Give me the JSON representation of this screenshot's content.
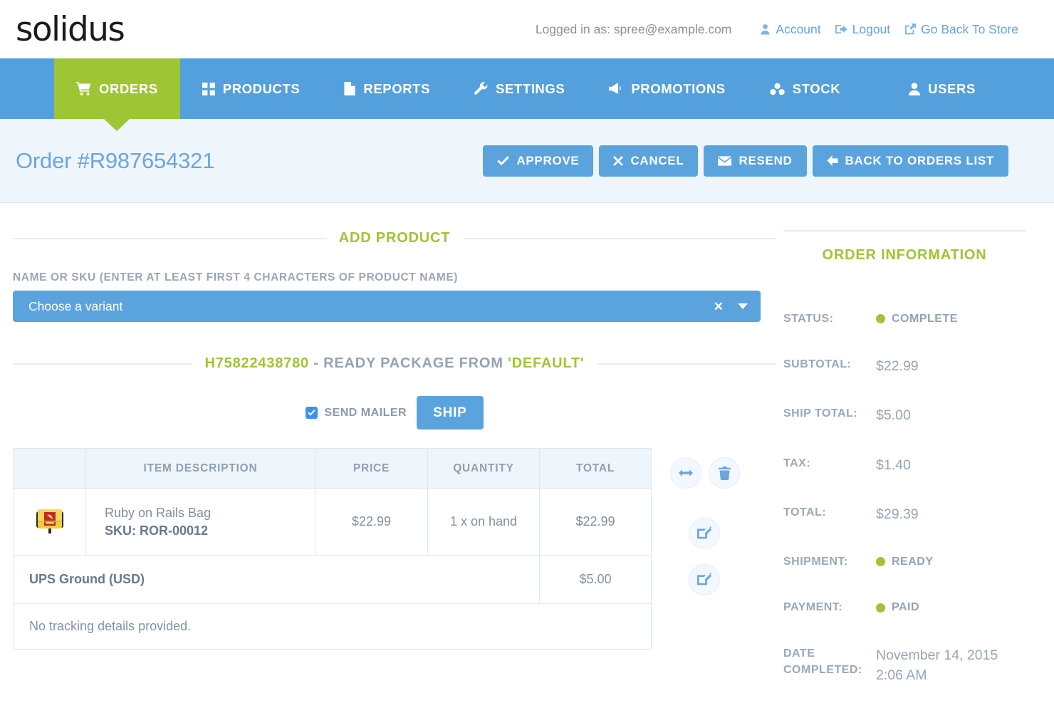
{
  "brand": {
    "logo_text": "solidus"
  },
  "header": {
    "logged_in_text": "Logged in as: spree@example.com",
    "links": [
      {
        "label": "Account",
        "icon": "user-icon"
      },
      {
        "label": "Logout",
        "icon": "logout-icon"
      },
      {
        "label": "Go Back To Store",
        "icon": "external-link-icon"
      }
    ]
  },
  "nav": {
    "items": [
      {
        "label": "ORDERS",
        "icon": "shopping-cart-icon",
        "active": true
      },
      {
        "label": "PRODUCTS",
        "icon": "grid-icon",
        "active": false
      },
      {
        "label": "REPORTS",
        "icon": "file-icon",
        "active": false
      },
      {
        "label": "SETTINGS",
        "icon": "wrench-icon",
        "active": false
      },
      {
        "label": "PROMOTIONS",
        "icon": "bullhorn-icon",
        "active": false
      },
      {
        "label": "STOCK",
        "icon": "cubes-icon",
        "active": false
      },
      {
        "label": "USERS",
        "icon": "user-icon",
        "active": false
      }
    ]
  },
  "titlebar": {
    "title": "Order #R987654321",
    "buttons": [
      {
        "label": "APPROVE",
        "icon": "check-icon"
      },
      {
        "label": "CANCEL",
        "icon": "times-icon"
      },
      {
        "label": "RESEND",
        "icon": "envelope-icon"
      },
      {
        "label": "BACK TO ORDERS LIST",
        "icon": "arrow-left-icon"
      }
    ]
  },
  "add_product": {
    "legend": "ADD PRODUCT",
    "field_label": "NAME OR SKU (ENTER AT LEAST FIRST 4 CHARACTERS OF PRODUCT NAME)",
    "select_placeholder": "Choose a variant",
    "clear_icon": "times-icon",
    "caret_icon": "chevron-down-icon"
  },
  "package": {
    "legend_code": "H75822438780",
    "legend_middle": " - READY PACKAGE FROM ",
    "legend_stock_location": "'DEFAULT'",
    "send_mailer_label": "SEND MAILER",
    "send_mailer_checked": true,
    "ship_button_label": "SHIP"
  },
  "items_table": {
    "columns": [
      "",
      "ITEM DESCRIPTION",
      "PRICE",
      "QUANTITY",
      "TOTAL"
    ],
    "rows": [
      {
        "image_alt": "Ruby on Rails Bag",
        "name": "Ruby on Rails Bag",
        "sku_label": "SKU:",
        "sku": "ROR-00012",
        "price": "$22.99",
        "quantity": "1 x on hand",
        "total": "$22.99"
      }
    ],
    "shipping_row": {
      "name": "UPS Ground (USD)",
      "total": "$5.00"
    },
    "tracking_row": {
      "text": "No tracking details provided."
    }
  },
  "row_actions": [
    {
      "icon": "arrows-h-icon",
      "name": "split-item-button"
    },
    {
      "icon": "trash-icon",
      "name": "delete-item-button"
    },
    {
      "icon": "pencil-square-icon",
      "name": "edit-shipping-method-button"
    },
    {
      "icon": "pencil-square-icon",
      "name": "edit-tracking-button"
    }
  ],
  "order_information": {
    "title": "ORDER INFORMATION",
    "rows": [
      {
        "key": "STATUS:",
        "value": "COMPLETE",
        "type": "status"
      },
      {
        "key": "SUBTOTAL:",
        "value": "$22.99",
        "type": "money"
      },
      {
        "key": "SHIP TOTAL:",
        "value": "$5.00",
        "type": "money"
      },
      {
        "key": "TAX:",
        "value": "$1.40",
        "type": "money"
      },
      {
        "key": "TOTAL:",
        "value": "$29.39",
        "type": "money"
      },
      {
        "key": "SHIPMENT:",
        "value": "READY",
        "type": "status"
      },
      {
        "key": "PAYMENT:",
        "value": "PAID",
        "type": "status"
      },
      {
        "key": "DATE COMPLETED:",
        "value": "November 14, 2015 2:06 AM",
        "type": "text"
      }
    ]
  },
  "colors": {
    "brand_blue": "#54a0dd",
    "brand_green": "#9ec534",
    "title_bar_bg": "#eef5fb",
    "text_gray": "#8fa0b1"
  }
}
